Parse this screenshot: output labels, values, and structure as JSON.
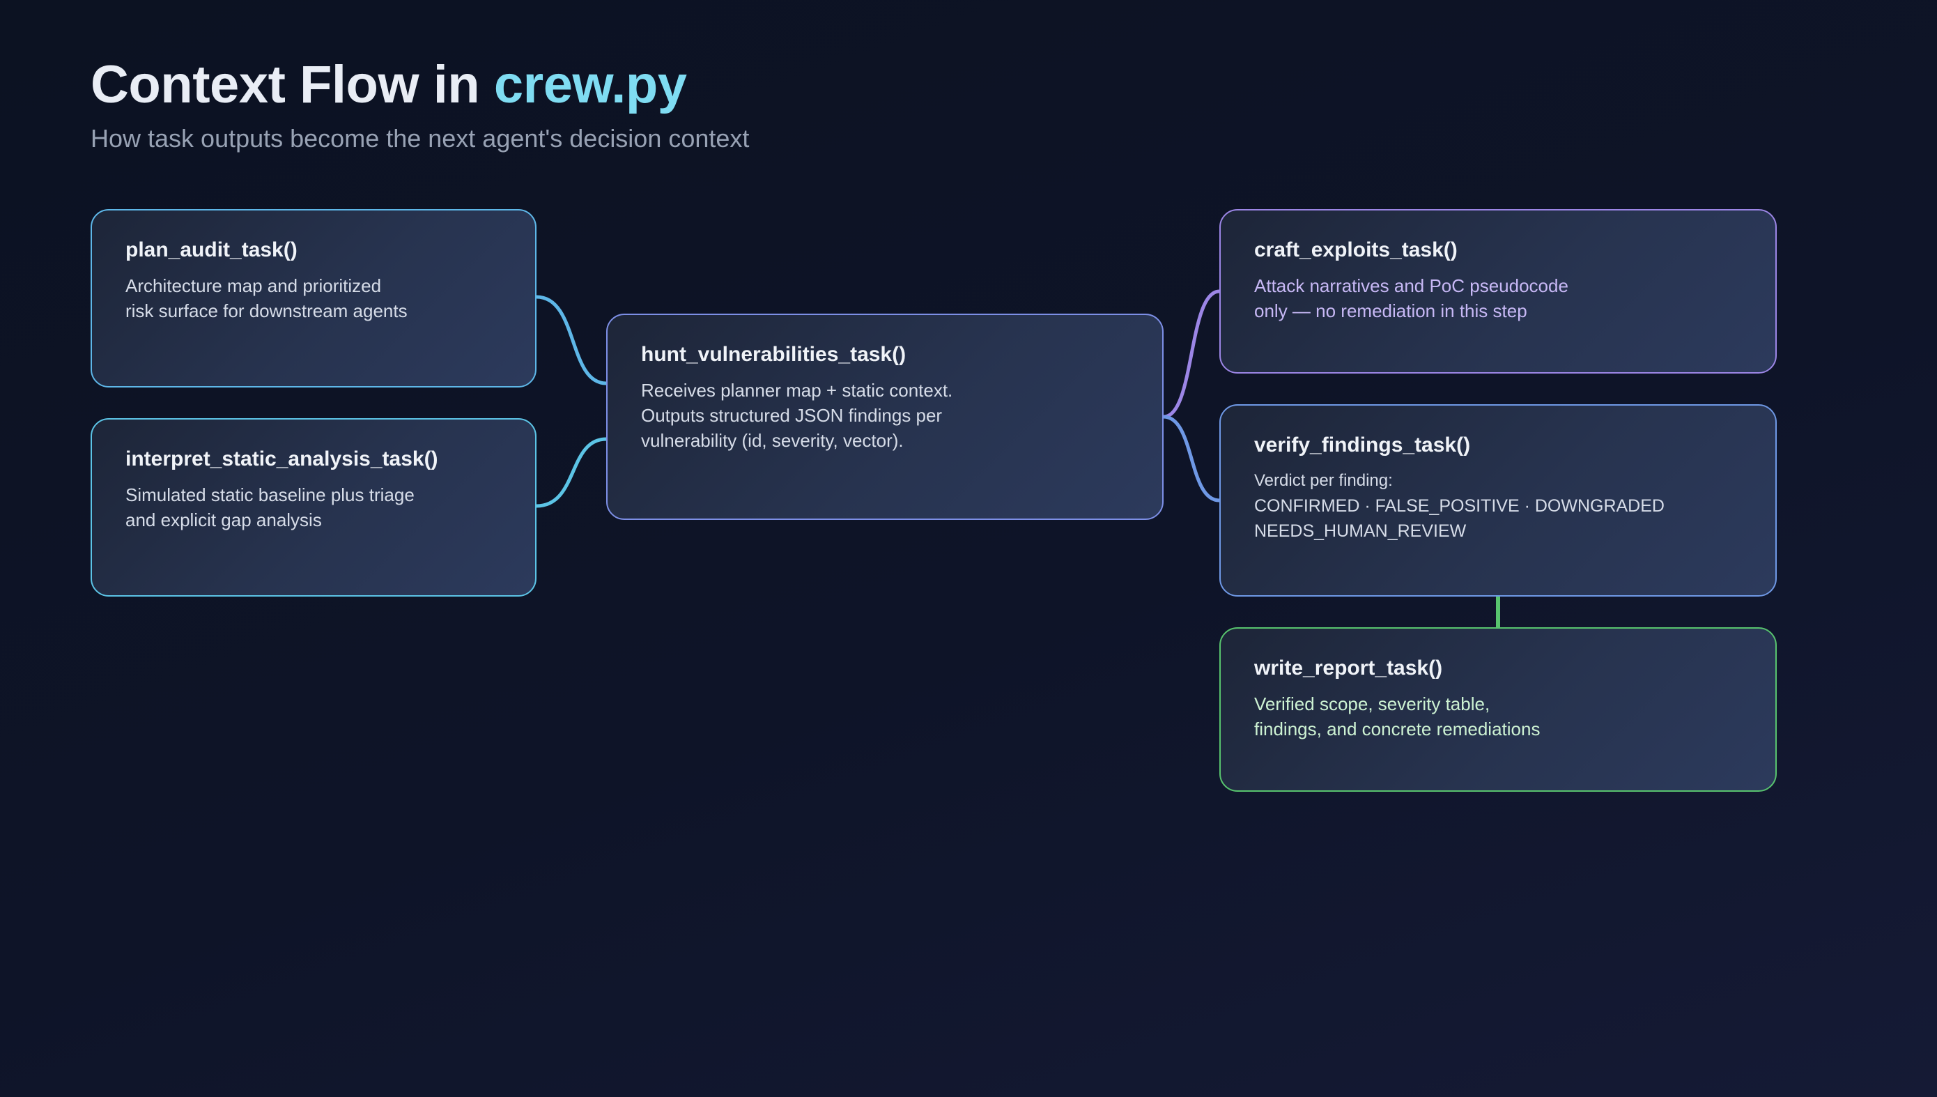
{
  "header": {
    "title_prefix": "Context Flow in ",
    "title_accent": "crew.py",
    "subtitle": "How task outputs become the next agent's decision context"
  },
  "colors": {
    "accent": "#7fdcf2",
    "edge_blue": "#5fb4e6",
    "edge_cyan": "#5cc4e6",
    "edge_purple": "#9c86e6",
    "edge_periwinkle": "#6f99e6",
    "edge_green": "#58c46e"
  },
  "nodes": {
    "plan": {
      "name": "plan_audit_task()",
      "desc": "Architecture map and prioritized\nrisk surface for downstream agents"
    },
    "interpret": {
      "name": "interpret_static_analysis_task()",
      "desc": "Simulated static baseline plus triage\nand explicit gap analysis"
    },
    "hunt": {
      "name": "hunt_vulnerabilities_task()",
      "desc": "Receives planner map + static context.\nOutputs structured JSON findings per\nvulnerability (id, severity, vector)."
    },
    "craft": {
      "name": "craft_exploits_task()",
      "desc": "Attack narratives and PoC pseudocode\nonly — no remediation in this step"
    },
    "verify": {
      "name": "verify_findings_task()",
      "intro": "Verdict per finding:",
      "verdicts": "CONFIRMED · FALSE_POSITIVE · DOWNGRADED\nNEEDS_HUMAN_REVIEW"
    },
    "report": {
      "name": "write_report_task()",
      "desc": "Verified scope, severity table,\nfindings, and concrete remediations"
    }
  }
}
